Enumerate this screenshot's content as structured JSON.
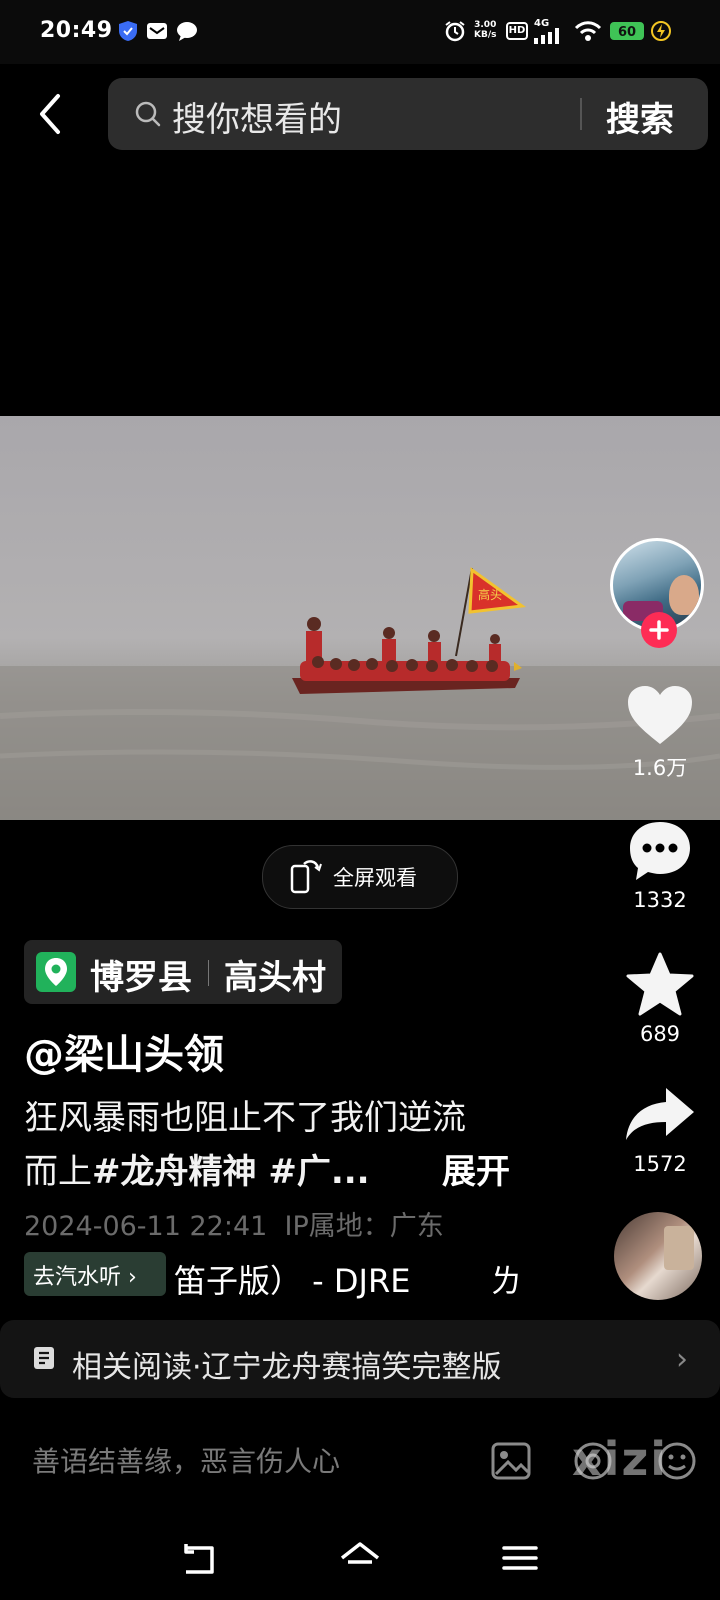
{
  "status_bar": {
    "time": "20:49",
    "net_speed_value": "3.00",
    "net_speed_unit": "KB/s",
    "hd_label": "HD",
    "network_label": "4G",
    "battery": "60",
    "icons": [
      "shield-icon",
      "mail-icon",
      "chat-bubble-icon",
      "alarm-icon",
      "signal-icon",
      "wifi-icon",
      "charging-icon"
    ]
  },
  "search": {
    "placeholder": "搜你想看的",
    "button": "搜索"
  },
  "video": {
    "flag_text": "高头"
  },
  "fullscreen": {
    "label": "全屏观看"
  },
  "actions": {
    "likes": "1.6万",
    "comments": "1332",
    "favorites": "689",
    "shares": "1572"
  },
  "post": {
    "location_area": "博罗县",
    "location_village": "高头村",
    "author": "@梁山头领",
    "desc_line1": "狂风暴雨也阻止不了我们逆流",
    "desc_line2_plain": "而上",
    "desc_line2_tags": "#龙舟精神 #广...",
    "expand": "展开",
    "datetime": "2024-06-11 22:41",
    "ip": "IP属地：广东"
  },
  "music": {
    "chip": "去汽水听",
    "title": "笛子版） - DJRE",
    "extra": "ㄌ"
  },
  "related": {
    "label": "相关阅读·辽宁龙舟赛搞笑完整版",
    "arrow": "›"
  },
  "comment": {
    "placeholder": "善语结善缘，恶言伤人心"
  },
  "watermark": "xizi",
  "colors": {
    "background": "#000000",
    "accent_red": "#fe2c55",
    "location_green": "#21b25b",
    "battery_green": "#3fc356"
  }
}
